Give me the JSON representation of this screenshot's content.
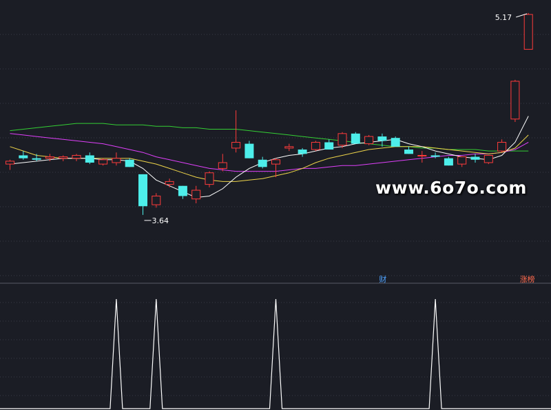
{
  "chart_data": {
    "type": "candlestick",
    "y_range": [
      3.4,
      5.25
    ],
    "colors": {
      "up": "#ff3b3b",
      "down": "#4deeea",
      "ma5": "#ffffff",
      "ma10": "#f0d64a",
      "ma20": "#e040fb",
      "ma60": "#34d034",
      "grid": "#3a3c46",
      "divider": "#5a5c66",
      "signal": "#ffffff"
    },
    "candles": [
      {
        "o": 4.13,
        "h": 4.16,
        "l": 4.09,
        "c": 4.15
      },
      {
        "o": 4.19,
        "h": 4.22,
        "l": 4.16,
        "c": 4.17
      },
      {
        "o": 4.17,
        "h": 4.2,
        "l": 4.15,
        "c": 4.16
      },
      {
        "o": 4.17,
        "h": 4.2,
        "l": 4.15,
        "c": 4.18
      },
      {
        "o": 4.17,
        "h": 4.19,
        "l": 4.15,
        "c": 4.18
      },
      {
        "o": 4.17,
        "h": 4.2,
        "l": 4.15,
        "c": 4.19
      },
      {
        "o": 4.19,
        "h": 4.21,
        "l": 4.13,
        "c": 4.14
      },
      {
        "o": 4.13,
        "h": 4.17,
        "l": 4.12,
        "c": 4.16
      },
      {
        "o": 4.14,
        "h": 4.21,
        "l": 4.12,
        "c": 4.17
      },
      {
        "o": 4.16,
        "h": 4.17,
        "l": 4.11,
        "c": 4.11
      },
      {
        "o": 4.06,
        "h": 4.06,
        "l": 3.78,
        "c": 3.84
      },
      {
        "o": 3.85,
        "h": 3.93,
        "l": 3.83,
        "c": 3.91
      },
      {
        "o": 3.99,
        "h": 4.03,
        "l": 3.97,
        "c": 4.01
      },
      {
        "o": 3.98,
        "h": 3.98,
        "l": 3.89,
        "c": 3.91
      },
      {
        "o": 3.89,
        "h": 3.98,
        "l": 3.86,
        "c": 3.95
      },
      {
        "o": 3.99,
        "h": 4.08,
        "l": 3.97,
        "c": 4.07
      },
      {
        "o": 4.1,
        "h": 4.2,
        "l": 4.08,
        "c": 4.14
      },
      {
        "o": 4.24,
        "h": 4.5,
        "l": 4.21,
        "c": 4.28
      },
      {
        "o": 4.27,
        "h": 4.29,
        "l": 4.17,
        "c": 4.17
      },
      {
        "o": 4.16,
        "h": 4.18,
        "l": 4.1,
        "c": 4.11
      },
      {
        "o": 4.13,
        "h": 4.17,
        "l": 4.04,
        "c": 4.16
      },
      {
        "o": 4.24,
        "h": 4.27,
        "l": 4.22,
        "c": 4.25
      },
      {
        "o": 4.23,
        "h": 4.24,
        "l": 4.18,
        "c": 4.2
      },
      {
        "o": 4.23,
        "h": 4.29,
        "l": 4.22,
        "c": 4.28
      },
      {
        "o": 4.28,
        "h": 4.3,
        "l": 4.23,
        "c": 4.23
      },
      {
        "o": 4.26,
        "h": 4.35,
        "l": 4.24,
        "c": 4.34
      },
      {
        "o": 4.34,
        "h": 4.35,
        "l": 4.27,
        "c": 4.27
      },
      {
        "o": 4.27,
        "h": 4.33,
        "l": 4.26,
        "c": 4.32
      },
      {
        "o": 4.32,
        "h": 4.34,
        "l": 4.25,
        "c": 4.29
      },
      {
        "o": 4.31,
        "h": 4.32,
        "l": 4.25,
        "c": 4.25
      },
      {
        "o": 4.23,
        "h": 4.25,
        "l": 4.2,
        "c": 4.2
      },
      {
        "o": 4.19,
        "h": 4.22,
        "l": 4.14,
        "c": 4.19
      },
      {
        "o": 4.19,
        "h": 4.21,
        "l": 4.17,
        "c": 4.18
      },
      {
        "o": 4.17,
        "h": 4.18,
        "l": 4.12,
        "c": 4.12
      },
      {
        "o": 4.13,
        "h": 4.18,
        "l": 4.11,
        "c": 4.18
      },
      {
        "o": 4.18,
        "h": 4.2,
        "l": 4.14,
        "c": 4.16
      },
      {
        "o": 4.14,
        "h": 4.19,
        "l": 4.13,
        "c": 4.19
      },
      {
        "o": 4.22,
        "h": 4.3,
        "l": 4.21,
        "c": 4.28
      },
      {
        "o": 4.44,
        "h": 4.71,
        "l": 4.42,
        "c": 4.7
      },
      {
        "o": 4.92,
        "h": 5.17,
        "l": 4.92,
        "c": 5.16
      }
    ],
    "ma5": [
      4.13,
      4.14,
      4.15,
      4.16,
      4.17,
      4.17,
      4.17,
      4.16,
      4.16,
      4.15,
      4.1,
      4.02,
      3.98,
      3.94,
      3.9,
      3.91,
      3.96,
      4.04,
      4.1,
      4.14,
      4.17,
      4.19,
      4.2,
      4.22,
      4.24,
      4.25,
      4.27,
      4.28,
      4.29,
      4.3,
      4.27,
      4.25,
      4.22,
      4.2,
      4.18,
      4.17,
      4.16,
      4.19,
      4.28,
      4.46
    ],
    "ma10": [
      4.25,
      4.22,
      4.19,
      4.18,
      4.17,
      4.17,
      4.17,
      4.17,
      4.17,
      4.17,
      4.15,
      4.13,
      4.1,
      4.07,
      4.04,
      4.02,
      4.01,
      4.01,
      4.02,
      4.03,
      4.05,
      4.07,
      4.1,
      4.14,
      4.17,
      4.19,
      4.21,
      4.23,
      4.24,
      4.25,
      4.25,
      4.25,
      4.24,
      4.23,
      4.22,
      4.21,
      4.2,
      4.21,
      4.24,
      4.33
    ],
    "ma20": [
      4.34,
      4.33,
      4.32,
      4.31,
      4.3,
      4.29,
      4.28,
      4.27,
      4.25,
      4.23,
      4.21,
      4.18,
      4.16,
      4.14,
      4.12,
      4.1,
      4.09,
      4.08,
      4.08,
      4.08,
      4.08,
      4.09,
      4.1,
      4.1,
      4.11,
      4.12,
      4.12,
      4.13,
      4.14,
      4.15,
      4.16,
      4.17,
      4.18,
      4.19,
      4.19,
      4.2,
      4.2,
      4.21,
      4.23,
      4.28
    ],
    "ma60": [
      4.36,
      4.37,
      4.38,
      4.39,
      4.4,
      4.41,
      4.41,
      4.41,
      4.4,
      4.4,
      4.4,
      4.39,
      4.39,
      4.38,
      4.38,
      4.37,
      4.37,
      4.37,
      4.36,
      4.35,
      4.34,
      4.33,
      4.32,
      4.31,
      4.3,
      4.29,
      4.28,
      4.27,
      4.26,
      4.25,
      4.25,
      4.24,
      4.24,
      4.23,
      4.23,
      4.23,
      4.22,
      4.22,
      4.22,
      4.22
    ],
    "high_label": "5.17",
    "low_label": "3.64",
    "marker_cai": "财",
    "marker_zhangbang": "涨榜",
    "signals": [
      8,
      11,
      20,
      32
    ]
  },
  "watermark": "www.6o7o.com"
}
